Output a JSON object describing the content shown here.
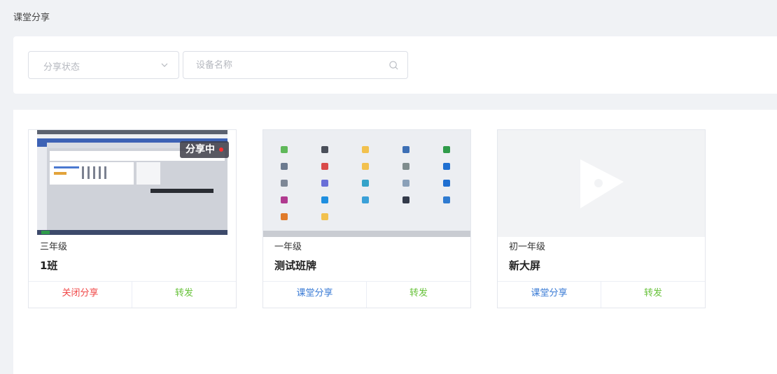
{
  "page_title": "课堂分享",
  "filters": {
    "status_placeholder": "分享状态",
    "device_placeholder": "设备名称"
  },
  "cards": [
    {
      "grade": "三年级",
      "name": "1班",
      "badge": "分享中",
      "action_left": "关闭分享",
      "action_right": "转发",
      "action_left_color": "#f04848"
    },
    {
      "grade": "一年级",
      "name": "测试班牌",
      "action_left": "课堂分享",
      "action_right": "转发",
      "action_left_color": "#3a7bd5"
    },
    {
      "grade": "初一年级",
      "name": "新大屏",
      "action_left": "课堂分享",
      "action_right": "转发",
      "action_left_color": "#3a7bd5"
    }
  ],
  "icons": {
    "select": "chevron-down-icon",
    "search": "search-icon",
    "placeholder_thumb": "video-play-icon"
  },
  "colors": {
    "close_share": "#f04848",
    "forward": "#67c23a",
    "share": "#3a7bd5"
  }
}
